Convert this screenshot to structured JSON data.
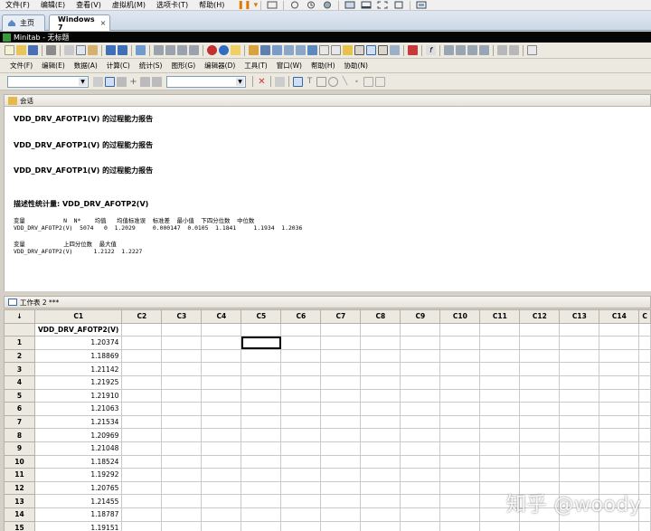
{
  "host_menu": [
    "文件(F)",
    "编辑(E)",
    "查看(V)",
    "虚拟机(M)",
    "选项卡(T)",
    "帮助(H)"
  ],
  "host_tabs": [
    {
      "label": "主页",
      "active": false
    },
    {
      "label": "Windows 7",
      "active": true
    }
  ],
  "host_tab_close": "×",
  "window_title": "Minitab - 无标题",
  "menu": [
    "文件(F)",
    "编辑(E)",
    "数据(A)",
    "计算(C)",
    "统计(S)",
    "图形(G)",
    "编辑器(D)",
    "工具(T)",
    "窗口(W)",
    "帮助(H)",
    "协助(N)"
  ],
  "session": {
    "title": "会话",
    "reports": [
      "VDD_DRV_AFOTP1(V) 的过程能力报告",
      "VDD_DRV_AFOTP1(V) 的过程能力报告",
      "VDD_DRV_AFOTP1(V) 的过程能力报告"
    ],
    "desc_title": "描述性统计量: VDD_DRV_AFOTP2(V)",
    "table1_header": "变量           N  N*    均值   均值标准误  标准差  最小值  下四分位数  中位数",
    "table1_row": "VDD_DRV_AFOTP2(V)  5074   0  1.2029     0.000147  0.0105  1.1841     1.1934  1.2036",
    "table2_header": "变量           上四分位数  最大值",
    "table2_row": "VDD_DRV_AFOTP2(V)      1.2122  1.2227"
  },
  "worksheet": {
    "title": "工作表 2 ***",
    "corner": "↓",
    "columns": [
      "C1",
      "C2",
      "C3",
      "C4",
      "C5",
      "C6",
      "C7",
      "C8",
      "C9",
      "C10",
      "C11",
      "C12",
      "C13",
      "C14",
      "C"
    ],
    "column_names": [
      "VDD_DRV_AFOTP2(V)",
      "",
      "",
      "",
      "",
      "",
      "",
      "",
      "",
      "",
      "",
      "",
      "",
      "",
      ""
    ],
    "rows": [
      {
        "n": "1",
        "v": "1.20374"
      },
      {
        "n": "2",
        "v": "1.18869"
      },
      {
        "n": "3",
        "v": "1.21142"
      },
      {
        "n": "4",
        "v": "1.21925"
      },
      {
        "n": "5",
        "v": "1.21910"
      },
      {
        "n": "6",
        "v": "1.21063"
      },
      {
        "n": "7",
        "v": "1.21534"
      },
      {
        "n": "8",
        "v": "1.20969"
      },
      {
        "n": "9",
        "v": "1.21048"
      },
      {
        "n": "10",
        "v": "1.18524"
      },
      {
        "n": "11",
        "v": "1.19292"
      },
      {
        "n": "12",
        "v": "1.20765"
      },
      {
        "n": "13",
        "v": "1.21455"
      },
      {
        "n": "14",
        "v": "1.18787"
      },
      {
        "n": "15",
        "v": "1.19151"
      }
    ]
  },
  "watermark": "知乎 @woody"
}
